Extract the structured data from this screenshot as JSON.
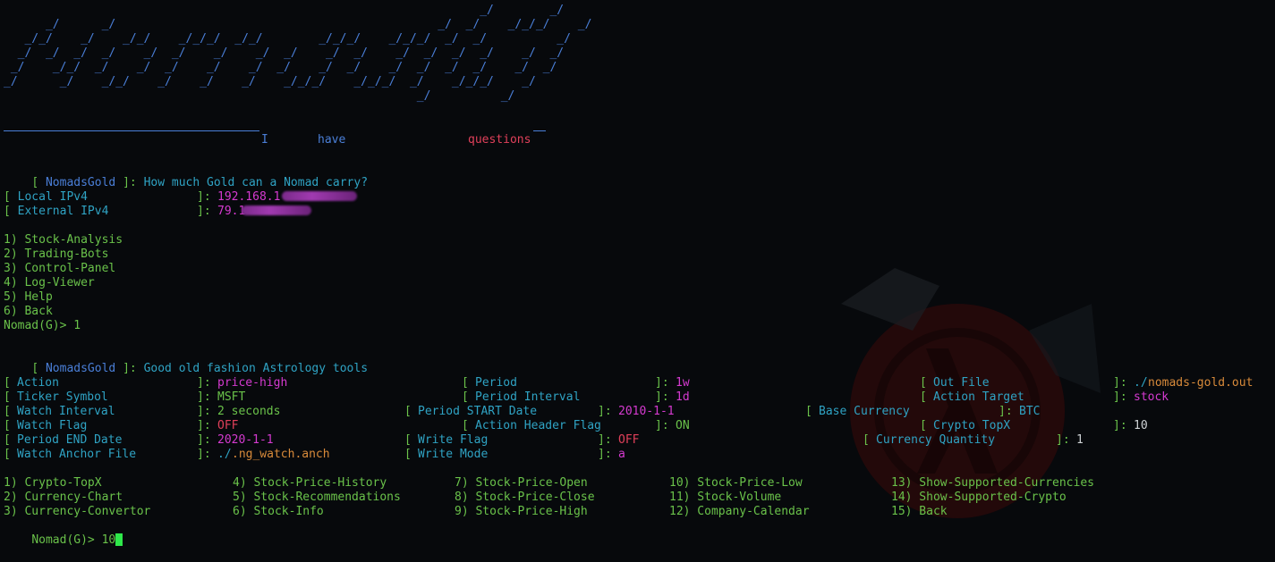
{
  "banner": {
    "ascii_art": "                                                                    _/        _/\n      _/      _/                                              _/  _/    _/_/_/    _/\n   _/_/    _/    _/_/    _/_/_/  _/_/        _/_/_/    _/_/_/  _/  _/          _/\n  _/  _/  _/  _/    _/  _/    _/    _/  _/    _/  _/    _/  _/  _/  _/    _/  _/\n _/    _/_/  _/    _/  _/    _/    _/  _/    _/  _/    _/  _/  _/  _/    _/  _/\n_/      _/    _/_/    _/    _/    _/    _/_/_/    _/_/_/  _/    _/_/_/    _/\n                                                           _/          _/",
    "tagline_1": "I",
    "tagline_2": "have",
    "tagline_3": "questions"
  },
  "header1": {
    "tag": "NomadsGold",
    "message": "How much Gold can a Nomad carry?"
  },
  "net": {
    "local_label": "Local IPv4",
    "local_value": "192.168.1",
    "external_label": "External IPv4",
    "external_value": "79.1"
  },
  "main_menu": [
    "1) Stock-Analysis",
    "2) Trading-Bots",
    "3) Control-Panel",
    "4) Log-Viewer",
    "5) Help",
    "6) Back"
  ],
  "prompt1": {
    "prompt": "Nomad(G)>",
    "input": "1"
  },
  "header2": {
    "tag": "NomadsGold",
    "message": "Good old fashion Astrology tools"
  },
  "settings": {
    "action_label": "Action",
    "action_value": "price-high",
    "period_label": "Period",
    "period_value": "1w",
    "outfile_label": "Out File",
    "outfile_prefix": "./",
    "outfile_value": "nomads-gold.out",
    "ticker_label": "Ticker Symbol",
    "ticker_value": "MSFT",
    "interval_label": "Period Interval",
    "interval_value": "1d",
    "target_label": "Action Target",
    "target_value": "stock",
    "watch_interval_label": "Watch Interval",
    "watch_interval_value": "2 seconds",
    "start_label": "Period START Date",
    "start_value": "2010-1-1",
    "basecur_label": "Base Currency",
    "basecur_value": "BTC",
    "watch_flag_label": "Watch Flag",
    "watch_flag_value": "OFF",
    "header_flag_label": "Action Header Flag",
    "header_flag_value": "ON",
    "topx_label": "Crypto TopX",
    "topx_value": "10",
    "end_label": "Period END Date",
    "end_value": "2020-1-1",
    "write_flag_label": "Write Flag",
    "write_flag_value": "OFF",
    "qty_label": "Currency Quantity",
    "qty_value": "1",
    "anchor_label": "Watch Anchor File",
    "anchor_prefix": "./",
    "anchor_value": ".ng_watch.anch",
    "write_mode_label": "Write Mode",
    "write_mode_value": "a"
  },
  "tools_menu": {
    "col1": [
      "1) Crypto-TopX",
      "2) Currency-Chart",
      "3) Currency-Convertor"
    ],
    "col2": [
      "4) Stock-Price-History",
      "5) Stock-Recommendations",
      "6) Stock-Info"
    ],
    "col3": [
      "7) Stock-Price-Open",
      "8) Stock-Price-Close",
      "9) Stock-Price-High"
    ],
    "col4": [
      "10) Stock-Price-Low",
      "11) Stock-Volume",
      "12) Company-Calendar"
    ],
    "col5": [
      "13) Show-Supported-Currencies",
      "14) Show-Supported-Crypto",
      "15) Back"
    ]
  },
  "prompt2": {
    "prompt": "Nomad(G)>",
    "input": "10"
  },
  "colors": {
    "bracket": "#2fa3c4",
    "label": "#2fa3c4",
    "value_magenta": "#d53ad0",
    "value_green": "#6ac24a",
    "menu": "#6ac24a",
    "banner": "#4a7fd8",
    "cursor": "#2ee84a"
  }
}
